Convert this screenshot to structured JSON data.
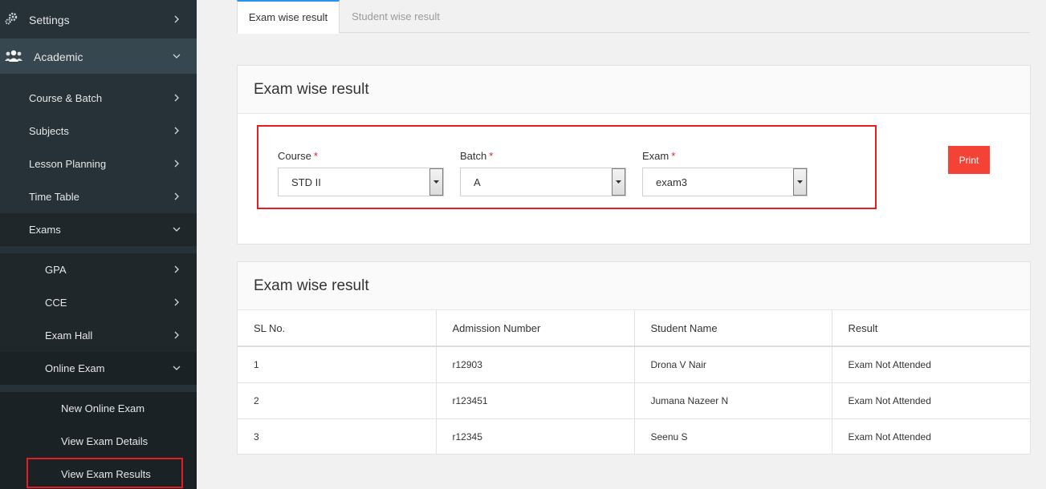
{
  "sidebar": {
    "settings": "Settings",
    "academic": "Academic",
    "course_batch": "Course & Batch",
    "subjects": "Subjects",
    "lesson_planning": "Lesson Planning",
    "time_table": "Time Table",
    "exams": "Exams",
    "gpa": "GPA",
    "cce": "CCE",
    "exam_hall": "Exam Hall",
    "online_exam": "Online Exam",
    "new_online_exam": "New Online Exam",
    "view_exam_details": "View Exam Details",
    "view_exam_results": "View Exam Results"
  },
  "tabs": {
    "exam_wise": "Exam wise result",
    "student_wise": "Student wise result"
  },
  "filter_panel": {
    "title": "Exam wise result",
    "course_label": "Course",
    "course_value": "STD II",
    "batch_label": "Batch",
    "batch_value": "A",
    "exam_label": "Exam",
    "exam_value": "exam3",
    "required_mark": "*",
    "print_label": "Print"
  },
  "results_panel": {
    "title": "Exam wise result",
    "columns": [
      "SL No.",
      "Admission Number",
      "Student Name",
      "Result"
    ],
    "rows": [
      [
        "1",
        "r12903",
        "Drona V Nair",
        "Exam Not Attended"
      ],
      [
        "2",
        "r123451",
        "Jumana Nazeer N",
        "Exam Not Attended"
      ],
      [
        "3",
        "r12345",
        "Seenu S",
        "Exam Not Attended"
      ]
    ]
  },
  "colors": {
    "sidebar_bg": "#263238",
    "accent_blue": "#2196f3",
    "print_red": "#f44336",
    "highlight_red": "#e31e24"
  },
  "icons": {
    "settings": "gears-icon",
    "academic": "users-icon",
    "chevron": "chevron-icon"
  }
}
